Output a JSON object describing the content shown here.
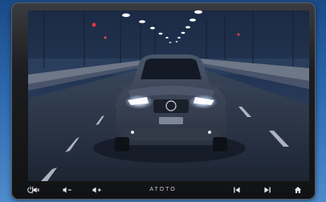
{
  "device": {
    "brand": "ATOTO",
    "screen": {
      "scene": "night-highway-car-photo"
    },
    "controls": [
      {
        "name": "power-mute-button",
        "icon": "power-mute-icon"
      },
      {
        "name": "volume-down-button",
        "icon": "volume-down-icon"
      },
      {
        "name": "volume-up-button",
        "icon": "volume-up-icon"
      },
      {
        "name": "previous-track-button",
        "icon": "skip-previous-icon"
      },
      {
        "name": "next-track-button",
        "icon": "skip-next-icon"
      },
      {
        "name": "home-button",
        "icon": "home-icon"
      }
    ]
  },
  "colors": {
    "background": "#2c68ad",
    "bezel": "#1c1d20",
    "icon": "#e8e8e8"
  }
}
